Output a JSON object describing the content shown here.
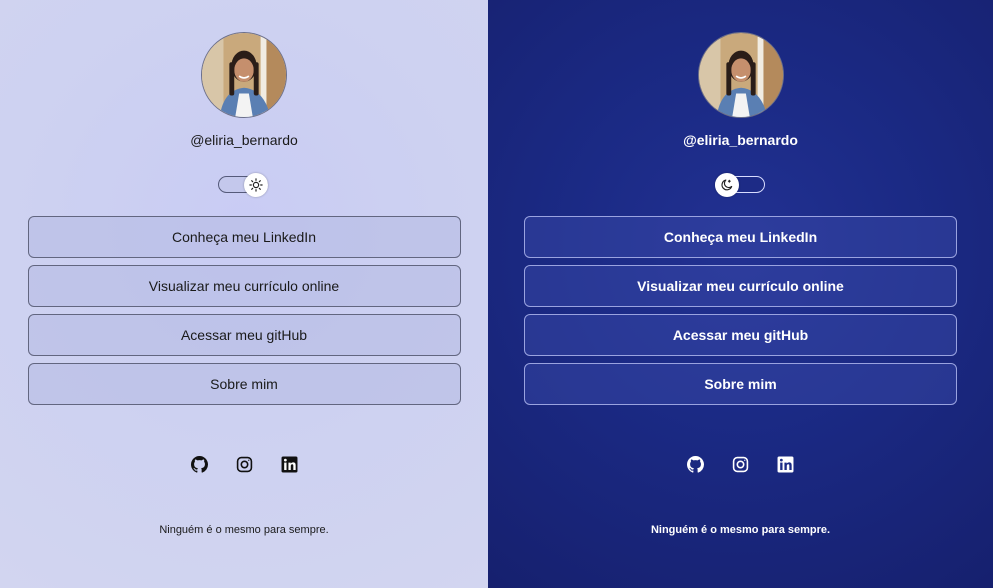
{
  "profile": {
    "username": "@eliria_bernardo"
  },
  "theme_toggle": {
    "light_icon": "sun-icon",
    "dark_icon": "moon-icon"
  },
  "links": [
    {
      "label": "Conheça meu LinkedIn"
    },
    {
      "label": "Visualizar meu currículo online"
    },
    {
      "label": "Acessar meu gitHub"
    },
    {
      "label": "Sobre mim"
    }
  ],
  "socials": [
    {
      "icon": "github-icon"
    },
    {
      "icon": "instagram-icon"
    },
    {
      "icon": "linkedin-icon"
    }
  ],
  "footer": {
    "quote": "Ninguém é o mesmo para sempre."
  },
  "colors": {
    "light_background": "#cdd1f1",
    "dark_background": "#1b2a85"
  }
}
